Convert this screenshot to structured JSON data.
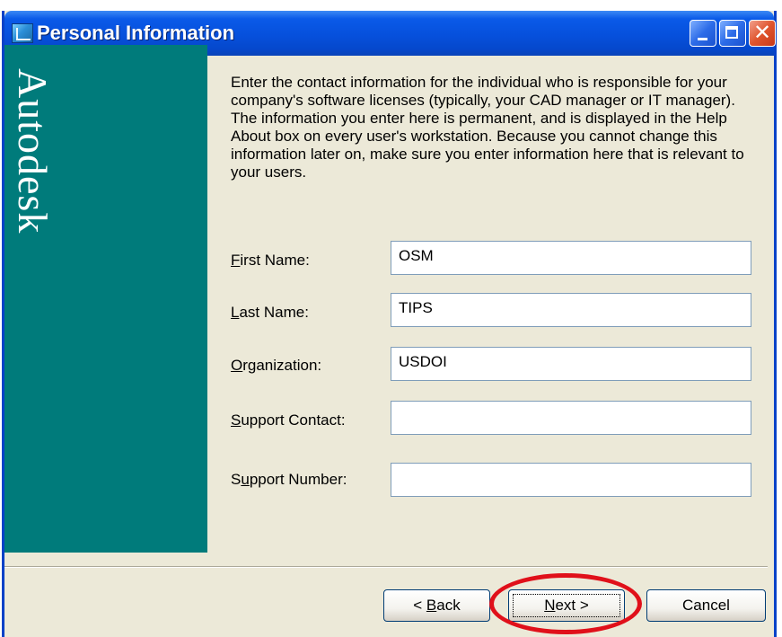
{
  "window": {
    "title": "Personal Information",
    "close_glyph": "✕"
  },
  "sidebar": {
    "brand": "Autodesk"
  },
  "intro_text": "Enter the contact information for the individual who is responsible for your company's software licenses (typically, your CAD manager or IT manager).  The information you enter here is permanent, and is displayed in the Help About box on every user's workstation. Because you cannot change this information later on, make sure you enter information here that is relevant to your users.",
  "form": {
    "first_name": {
      "label_hot": "F",
      "label_rest": "irst Name:",
      "value": "OSM"
    },
    "last_name": {
      "label_hot": "L",
      "label_rest": "ast Name:",
      "value": "TIPS"
    },
    "organization": {
      "label_hot": "O",
      "label_rest": "rganization:",
      "value": "USDOI"
    },
    "support_contact": {
      "label_hot": "S",
      "label_rest": "upport Contact:",
      "value": ""
    },
    "support_number": {
      "label_pre": "S",
      "label_hot": "u",
      "label_rest": "pport Number:",
      "value": ""
    }
  },
  "buttons": {
    "back": {
      "prefix": "< ",
      "hot": "B",
      "rest": "ack"
    },
    "next": {
      "hot": "N",
      "rest": "ext >"
    },
    "cancel": {
      "label": "Cancel"
    }
  },
  "colors": {
    "sidebar": "#007b7b",
    "titlebar": "#0650dc",
    "highlight": "#e0101a"
  }
}
